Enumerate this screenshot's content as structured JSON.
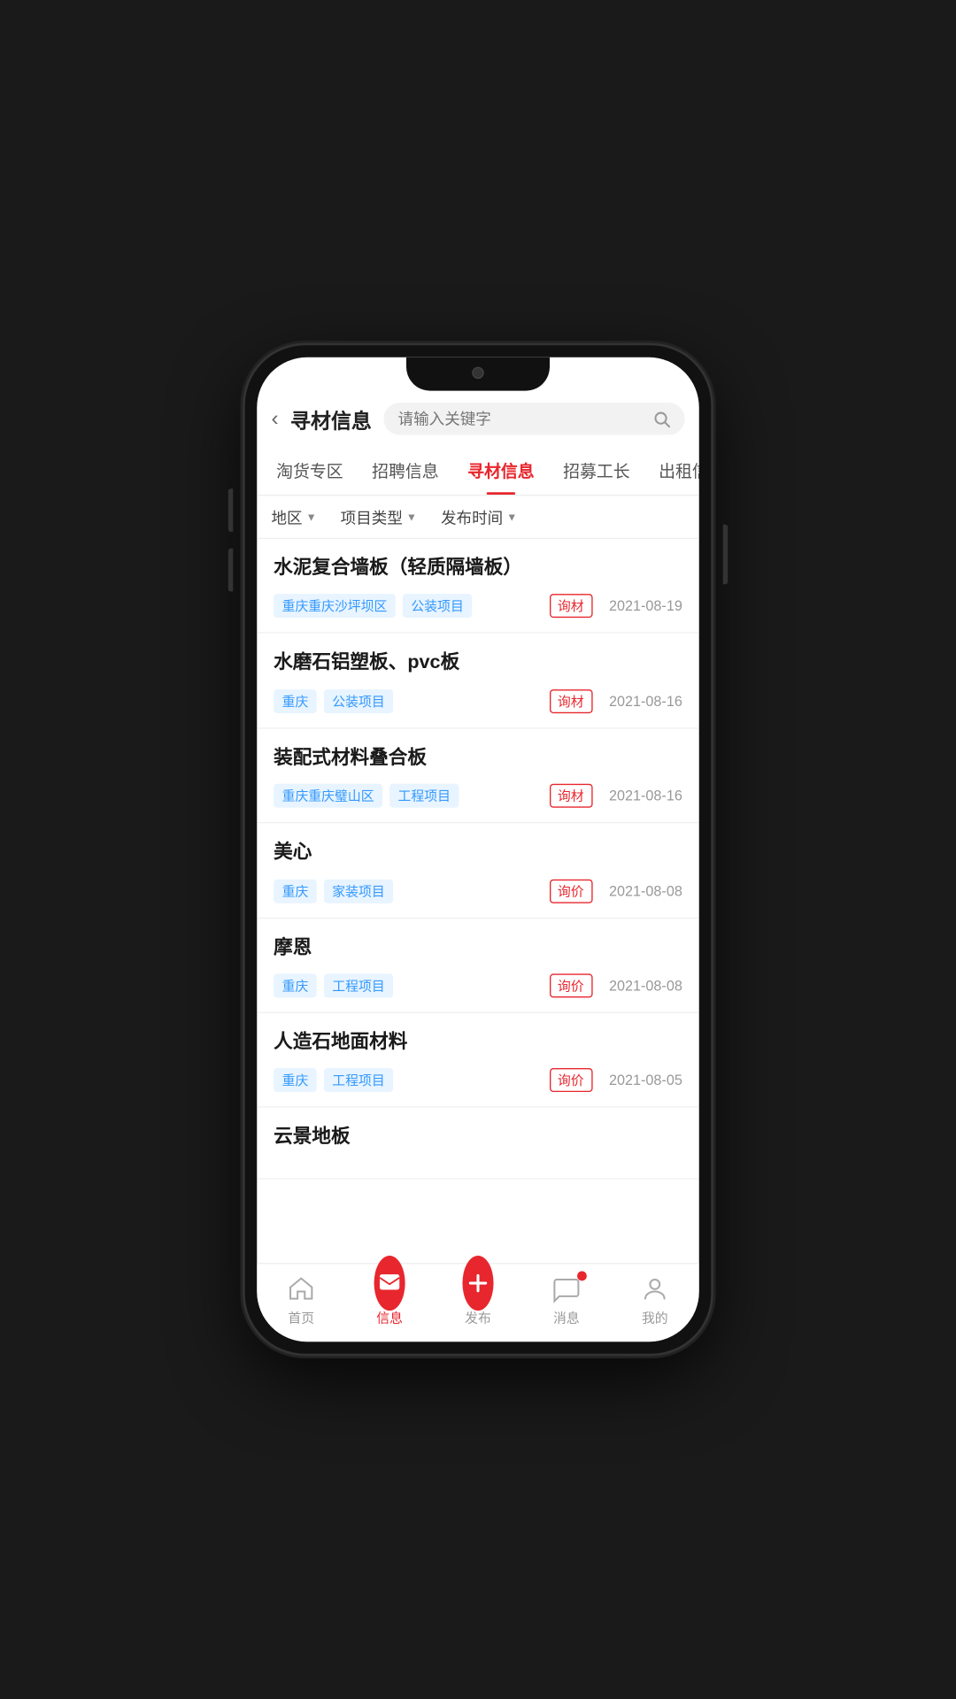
{
  "header": {
    "back_label": "‹",
    "title": "寻材信息",
    "search_placeholder": "请输入关键字"
  },
  "tabs": [
    {
      "label": "淘货专区",
      "active": false
    },
    {
      "label": "招聘信息",
      "active": false
    },
    {
      "label": "寻材信息",
      "active": true
    },
    {
      "label": "招募工长",
      "active": false
    },
    {
      "label": "出租信",
      "active": false
    }
  ],
  "filters": [
    {
      "label": "地区"
    },
    {
      "label": "项目类型"
    },
    {
      "label": "发布时间"
    }
  ],
  "list_items": [
    {
      "title": "水泥复合墙板（轻质隔墙板）",
      "tags": [
        "重庆重庆沙坪坝区",
        "公装项目"
      ],
      "badge": "询材",
      "date": "2021-08-19"
    },
    {
      "title": "水磨石铝塑板、pvc板",
      "tags": [
        "重庆",
        "公装项目"
      ],
      "badge": "询材",
      "date": "2021-08-16"
    },
    {
      "title": "装配式材料叠合板",
      "tags": [
        "重庆重庆璧山区",
        "工程项目"
      ],
      "badge": "询材",
      "date": "2021-08-16"
    },
    {
      "title": "美心",
      "tags": [
        "重庆",
        "家装项目"
      ],
      "badge": "询价",
      "date": "2021-08-08"
    },
    {
      "title": "摩恩",
      "tags": [
        "重庆",
        "工程项目"
      ],
      "badge": "询价",
      "date": "2021-08-08"
    },
    {
      "title": "人造石地面材料",
      "tags": [
        "重庆",
        "工程项目"
      ],
      "badge": "询价",
      "date": "2021-08-05"
    },
    {
      "title": "云景地板",
      "tags": [],
      "badge": "",
      "date": ""
    }
  ],
  "bottom_nav": [
    {
      "label": "首页",
      "active": false,
      "type": "home"
    },
    {
      "label": "信息",
      "active": true,
      "type": "message"
    },
    {
      "label": "发布",
      "active": false,
      "type": "plus"
    },
    {
      "label": "消息",
      "active": false,
      "type": "chat"
    },
    {
      "label": "我的",
      "active": false,
      "type": "user"
    }
  ]
}
